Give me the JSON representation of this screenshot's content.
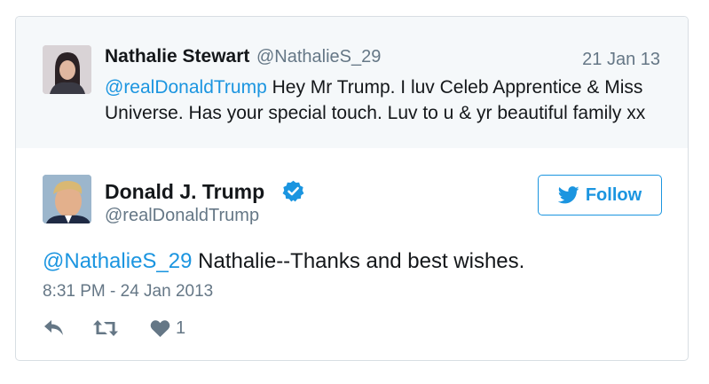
{
  "parent_tweet": {
    "name": "Nathalie Stewart",
    "handle": "@NathalieS_29",
    "time": "21 Jan 13",
    "mention": "@realDonaldTrump",
    "text_line1_rest": " Hey Mr Trump. I luv Celeb Apprentice & Miss",
    "text_line2": "Universe. Has your special touch. Luv to u & yr beautiful family xx"
  },
  "main_tweet": {
    "name": "Donald J. Trump",
    "verified": true,
    "handle": "@realDonaldTrump",
    "follow_label": "Follow",
    "mention": "@NathalieS_29",
    "text_rest": " Nathalie--Thanks and best wishes.",
    "timestamp": "8:31 PM - 24 Jan 2013",
    "like_count": "1"
  },
  "icons": {
    "verified": "verified-badge-icon",
    "follow": "twitter-bird-icon",
    "reply": "reply-icon",
    "retweet": "retweet-icon",
    "like": "heart-icon"
  },
  "colors": {
    "accent": "#1b95e0",
    "muted": "#657786",
    "text": "#14171a",
    "parent_bg": "#f5f8fa",
    "border": "#d8dee3"
  }
}
